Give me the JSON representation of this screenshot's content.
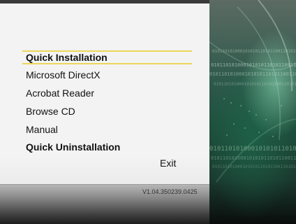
{
  "menu": {
    "items": [
      {
        "label": "Quick Installation",
        "bold": true,
        "selected": true
      },
      {
        "label": "Microsoft DirectX",
        "bold": false
      },
      {
        "label": "Acrobat Reader",
        "bold": false
      },
      {
        "label": "Browse CD",
        "bold": false
      },
      {
        "label": "Manual",
        "bold": false
      },
      {
        "label": "Quick Uninstallation",
        "bold": true
      }
    ],
    "exit_label": "Exit"
  },
  "footer": {
    "version": "V1.04.350239.0425"
  },
  "colors": {
    "panel": "#f3f3f3",
    "highlight": "#ecd65a",
    "text": "#111111",
    "art_green": "#2f5a4c"
  },
  "art": {
    "binary_text": "0101101010001010101101011001101010101"
  }
}
